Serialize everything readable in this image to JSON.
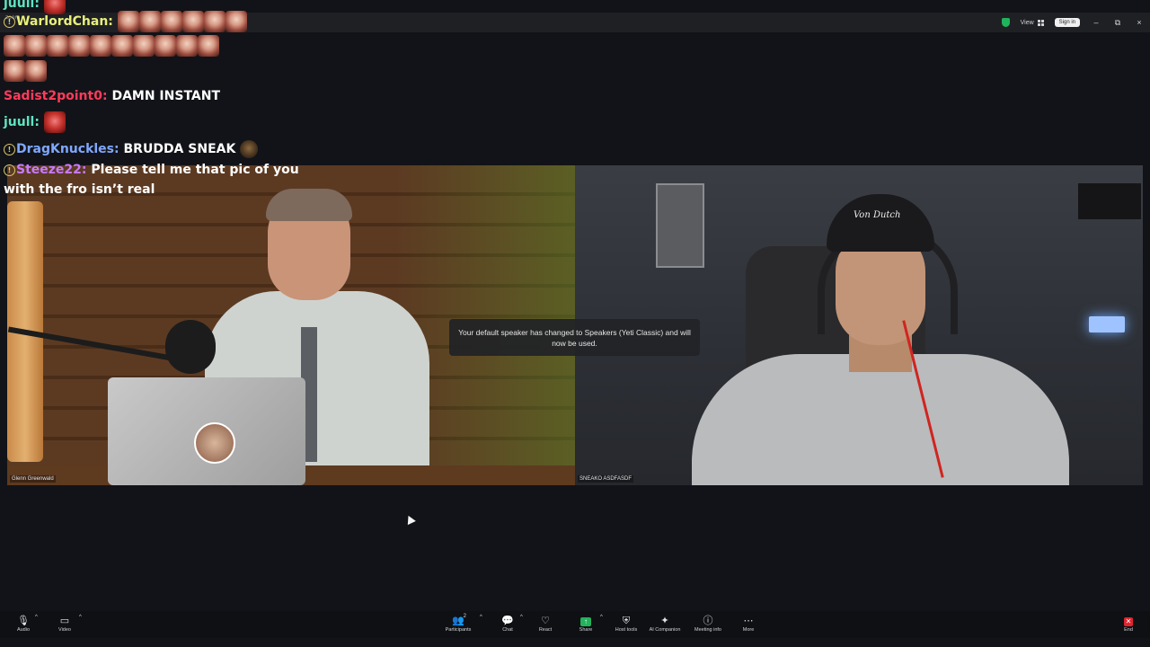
{
  "titlebar": {
    "app_badge": "zoom",
    "view_label": "View",
    "signin_label": "Sign in",
    "minimize": "–",
    "restore": "⧉",
    "close": "×"
  },
  "chat": [
    {
      "user": "juull",
      "color": "#5fe3c0",
      "text": ""
    },
    {
      "user": "WarlordChan",
      "color": "#e8f07a",
      "text": ""
    },
    {
      "user": "Sadist2point0",
      "color": "#ff3b5b",
      "text": "DAMN INSTANT"
    },
    {
      "user": "juull",
      "color": "#5fe3c0",
      "text": ""
    },
    {
      "user": "DragKnuckles",
      "color": "#7fa8ff",
      "text": "BRUDDA SNEAK"
    },
    {
      "user": "Steeze22",
      "color": "#c87aff",
      "text": "Please tell me that pic of you",
      "text2": "with the fro isn’t real"
    }
  ],
  "tiles": {
    "left_name": "Glenn Greenwald",
    "right_name": "SNEAKO ASDFASDF",
    "cap_logo": "Von Dutch"
  },
  "toast": "Your default speaker has changed to Speakers (Yeti Classic) and will now be used.",
  "toolbar": {
    "audio": "Audio",
    "video": "Video",
    "participants": "Participants",
    "participants_count": "2",
    "chat": "Chat",
    "react": "React",
    "share": "Share",
    "host_tools": "Host tools",
    "ai_companion": "AI Companion",
    "meeting_info": "Meeting info",
    "more": "More",
    "end": "End"
  },
  "colors": {
    "background": "#121318",
    "share_green": "#22b35c",
    "end_red": "#e0242e",
    "shield_green": "#1fb35b"
  }
}
